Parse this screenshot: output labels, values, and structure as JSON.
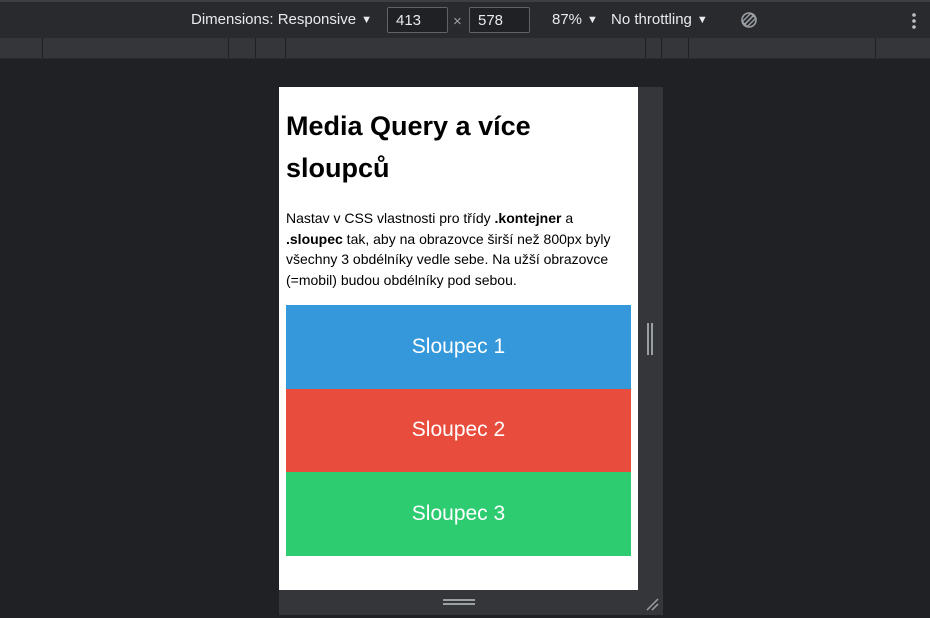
{
  "toolbar": {
    "dimensions_label": "Dimensions: Responsive",
    "width_value": "413",
    "times_symbol": "×",
    "height_value": "578",
    "zoom_label": "87%",
    "throttle_label": "No throttling",
    "caret": "▼",
    "rotate_icon": "rotate-icon",
    "more_icon": "more-vert-icon"
  },
  "page": {
    "title": "Media Query a více sloupců",
    "intro_1": "Nastav v CSS vlastnosti pro třídy ",
    "kontejner": ".kontejner",
    "intro_2": " a ",
    "sloupec": ".sloupec",
    "intro_3": " tak, aby na obrazovce širší než 800px byly všechny 3 obdélníky vedle sebe. Na užší obrazovce (=mobil) budou obdélníky pod sebou."
  },
  "columns": [
    {
      "label": "Sloupec 1",
      "color": "#3498db"
    },
    {
      "label": "Sloupec 2",
      "color": "#e74c3c"
    },
    {
      "label": "Sloupec 3",
      "color": "#2ecc71"
    }
  ],
  "colors": {
    "devtools_bg": "#202124",
    "toolbar_bg": "#292a2d",
    "toolbar_text": "#e8eaed",
    "page_bg": "#ffffff"
  }
}
